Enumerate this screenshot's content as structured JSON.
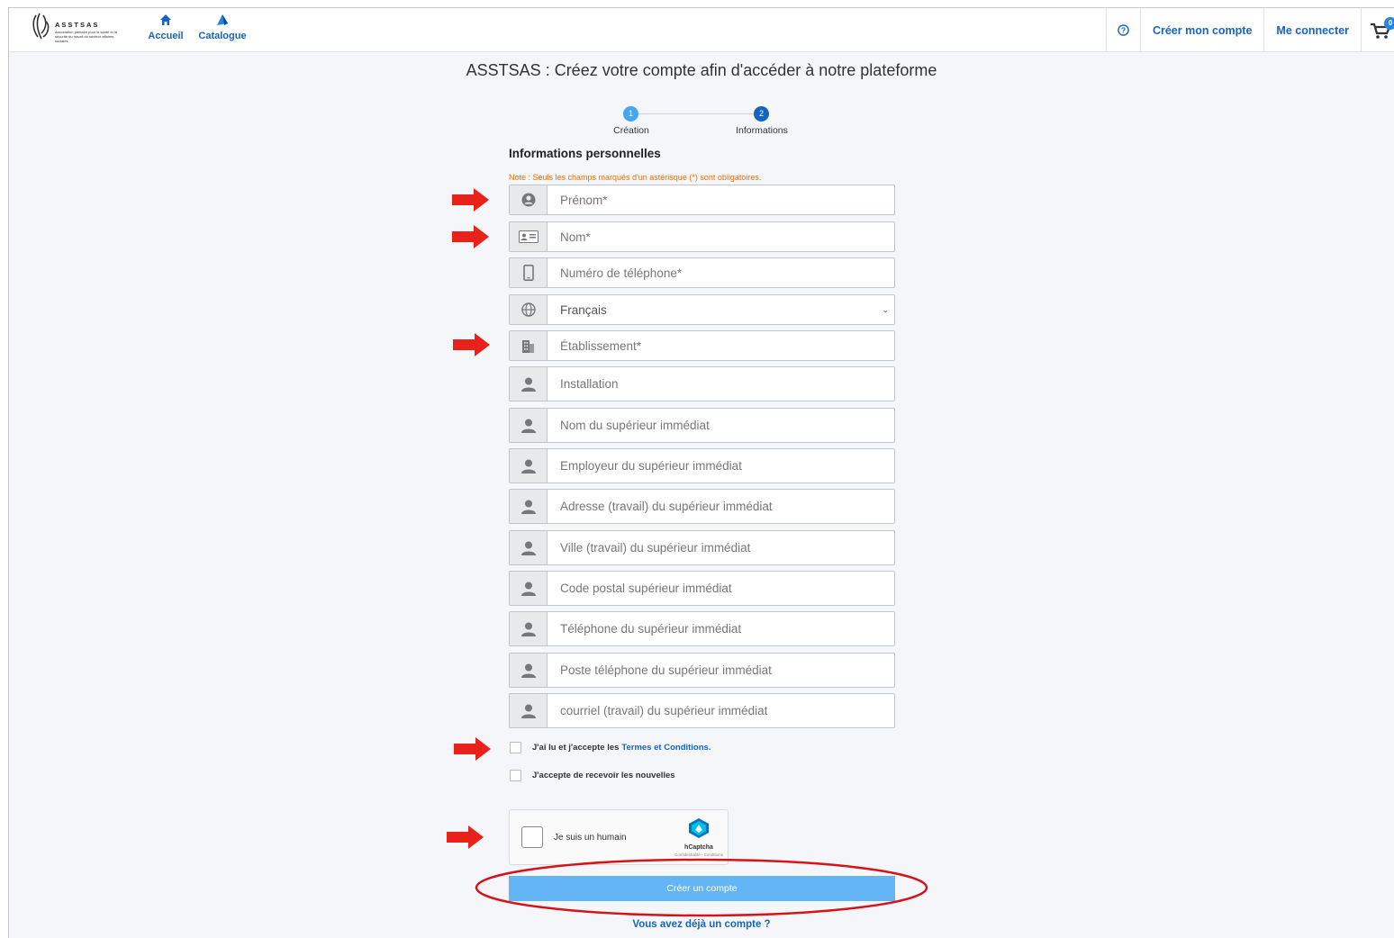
{
  "header": {
    "logo_title": "ASSTSAS",
    "logo_subtitle": "Association paritaire pour la santé et la sécurité du travail du secteur affaires sociales",
    "nav": [
      {
        "label": "Accueil",
        "icon": "home-icon"
      },
      {
        "label": "Catalogue",
        "icon": "catalogue-icon"
      }
    ],
    "create_account": "Créer mon compte",
    "login": "Me connecter",
    "cart_count": "0"
  },
  "page": {
    "title": "ASSTSAS : Créez votre compte afin d'accéder à notre plateforme",
    "steps": [
      {
        "number": "1",
        "label": "Création"
      },
      {
        "number": "2",
        "label": "Informations"
      }
    ],
    "section_title": "Informations personnelles",
    "note": "Note : Seuls les champs marqués d'un astérisque (*) sont obligatoires."
  },
  "form": {
    "fields": [
      {
        "placeholder": "Prénom*",
        "icon": "user-circle-icon"
      },
      {
        "placeholder": "Nom*",
        "icon": "id-card-icon"
      },
      {
        "placeholder": "Numéro de téléphone*",
        "icon": "mobile-phone-icon"
      },
      {
        "value": "Français",
        "icon": "globe-icon"
      },
      {
        "placeholder": "Établissement*",
        "icon": "building-icon"
      },
      {
        "placeholder": "Installation",
        "icon": "person-icon"
      },
      {
        "placeholder": "Nom du supérieur immédiat",
        "icon": "person-icon"
      },
      {
        "placeholder": "Employeur du supérieur immédiat",
        "icon": "person-icon"
      },
      {
        "placeholder": "Adresse (travail) du supérieur immédiat",
        "icon": "person-icon"
      },
      {
        "placeholder": "Ville (travail) du supérieur immédiat",
        "icon": "person-icon"
      },
      {
        "placeholder": "Code postal supérieur immédiat",
        "icon": "person-icon"
      },
      {
        "placeholder": "Téléphone du supérieur immédiat",
        "icon": "person-icon"
      },
      {
        "placeholder": "Poste téléphone du supérieur immédiat",
        "icon": "person-icon"
      },
      {
        "placeholder": "courriel (travail) du supérieur immédiat",
        "icon": "person-icon"
      }
    ],
    "terms_text": "J'ai lu et j'accepte les",
    "terms_link": "Termes et Conditions.",
    "newsletter_text": "J'accepte de recevoir les nouvelles",
    "captcha_text": "Je suis un humain",
    "captcha_brand": "hCaptcha",
    "captcha_links": "Confidentialité - Conditions",
    "submit_label": "Créer un compte",
    "have_account": "Vous avez déjà un compte ?"
  },
  "annotation_color": "#e8211b",
  "accent_color": "#1565c0"
}
